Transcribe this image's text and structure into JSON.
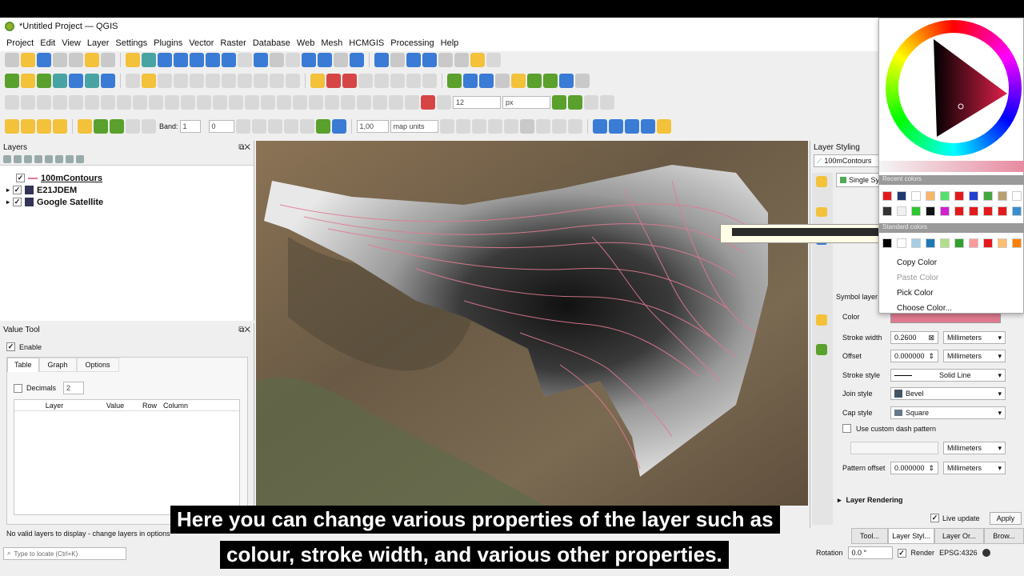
{
  "window": {
    "title": "*Untitled Project — QGIS"
  },
  "menu": [
    "Project",
    "Edit",
    "View",
    "Layer",
    "Settings",
    "Plugins",
    "Vector",
    "Raster",
    "Database",
    "Web",
    "Mesh",
    "HCMGIS",
    "Processing",
    "Help"
  ],
  "toolbar": {
    "band_label": "Band:",
    "band_value": "1",
    "offset_value": "0",
    "size_value": "12",
    "size_unit": "px",
    "width_value": "1,00",
    "width_unit": "map units"
  },
  "layers_panel": {
    "title": "Layers",
    "items": [
      {
        "name": "100mContours",
        "checked": true
      },
      {
        "name": "E21JDEM",
        "checked": true
      },
      {
        "name": "Google Satellite",
        "checked": true
      }
    ]
  },
  "value_tool": {
    "title": "Value Tool",
    "enable_label": "Enable",
    "tabs": [
      "Table",
      "Graph",
      "Options"
    ],
    "decimals_label": "Decimals",
    "decimals_value": "2",
    "columns": [
      "Layer",
      "Value",
      "Row",
      "Column"
    ],
    "status": "No valid layers to display - change layers in options"
  },
  "locator": {
    "placeholder": "Type to locate (Ctrl+K)"
  },
  "layer_styling": {
    "title": "Layer Styling",
    "layer": "100mContours",
    "renderer": "Single Sy",
    "section": "Symbol layer t",
    "props": {
      "color_label": "Color",
      "stroke_width_label": "Stroke width",
      "stroke_width": "0.2600",
      "offset_label": "Offset",
      "offset": "0.000000",
      "stroke_style_label": "Stroke style",
      "stroke_style": "Solid Line",
      "join_style_label": "Join style",
      "join_style": "Bevel",
      "cap_style_label": "Cap style",
      "cap_style": "Square",
      "custom_dash_label": "Use custom dash pattern",
      "pattern_offset_label": "Pattern offset",
      "pattern_offset": "0.000000",
      "unit": "Millimeters"
    },
    "layer_rendering": "Layer Rendering",
    "live_update": "Live update",
    "apply": "Apply",
    "bottom_tabs": [
      "Tool...",
      "Layer Styl...",
      "Layer Or...",
      "Brow..."
    ],
    "color_value": "#e07a90"
  },
  "status_bar": {
    "rotation_label": "Rotation",
    "rotation_value": "0.0 °",
    "render_label": "Render",
    "crs": "EPSG:4326"
  },
  "color_popup": {
    "recent_label": "Recent colors",
    "standard_label": "Standard colors",
    "menu": [
      "Copy Color",
      "Paste Color",
      "Pick Color",
      "Choose Color..."
    ],
    "recent_row1": [
      "#e31a1c",
      "#1f3a73",
      "#ffffff",
      "#f5b867",
      "#55e06b",
      "#e31a1c",
      "#2040d0",
      "#42a542",
      "#b8a070",
      "#ffffff"
    ],
    "recent_row2": [
      "#333333",
      "#f0f0f0",
      "#2ec62e",
      "#111111",
      "#d020d0",
      "#e31a1c",
      "#e31a1c",
      "#e31a1c",
      "#e31a1c",
      "#3a8fd0"
    ],
    "standard_row": [
      "#000000",
      "#ffffff",
      "#a6cee3",
      "#1f78b4",
      "#b2df8a",
      "#33a02c",
      "#fb9a99",
      "#e31a1c",
      "#fdbf6f",
      "#ff7f00"
    ]
  },
  "caption": {
    "line1": "Here you can change various properties of the layer such as",
    "line2": "colour, stroke width, and various other properties."
  }
}
